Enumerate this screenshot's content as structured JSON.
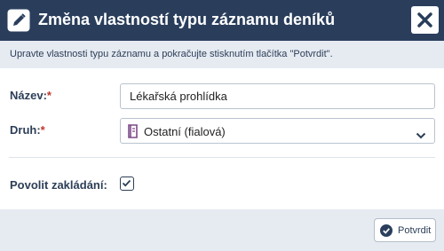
{
  "colors": {
    "header_bg": "#2a3e5c",
    "intro_bg": "#e6ebf2",
    "required": "#c0392b",
    "label": "#2c3e57",
    "purple_book": "#7d4a88"
  },
  "dialog": {
    "title": "Změna vlastností typu záznamu deníků",
    "header_icon": "edit-icon",
    "close_icon": "close-icon",
    "intro": "Upravte vlastnosti typu záznamu a pokračujte stisknutím tlačítka \"Potvrdit\"."
  },
  "form": {
    "name_label": "Název:",
    "name_required": "*",
    "name_value": "Lékařská prohlídka",
    "kind_label": "Druh:",
    "kind_required": "*",
    "kind_value": "Ostatní (fialová)",
    "kind_icon": "book-icon",
    "allow_label": "Povolit zakládání:",
    "allow_checked": true
  },
  "footer": {
    "confirm_label": "Potvrdit",
    "confirm_icon": "check-circle-icon"
  }
}
